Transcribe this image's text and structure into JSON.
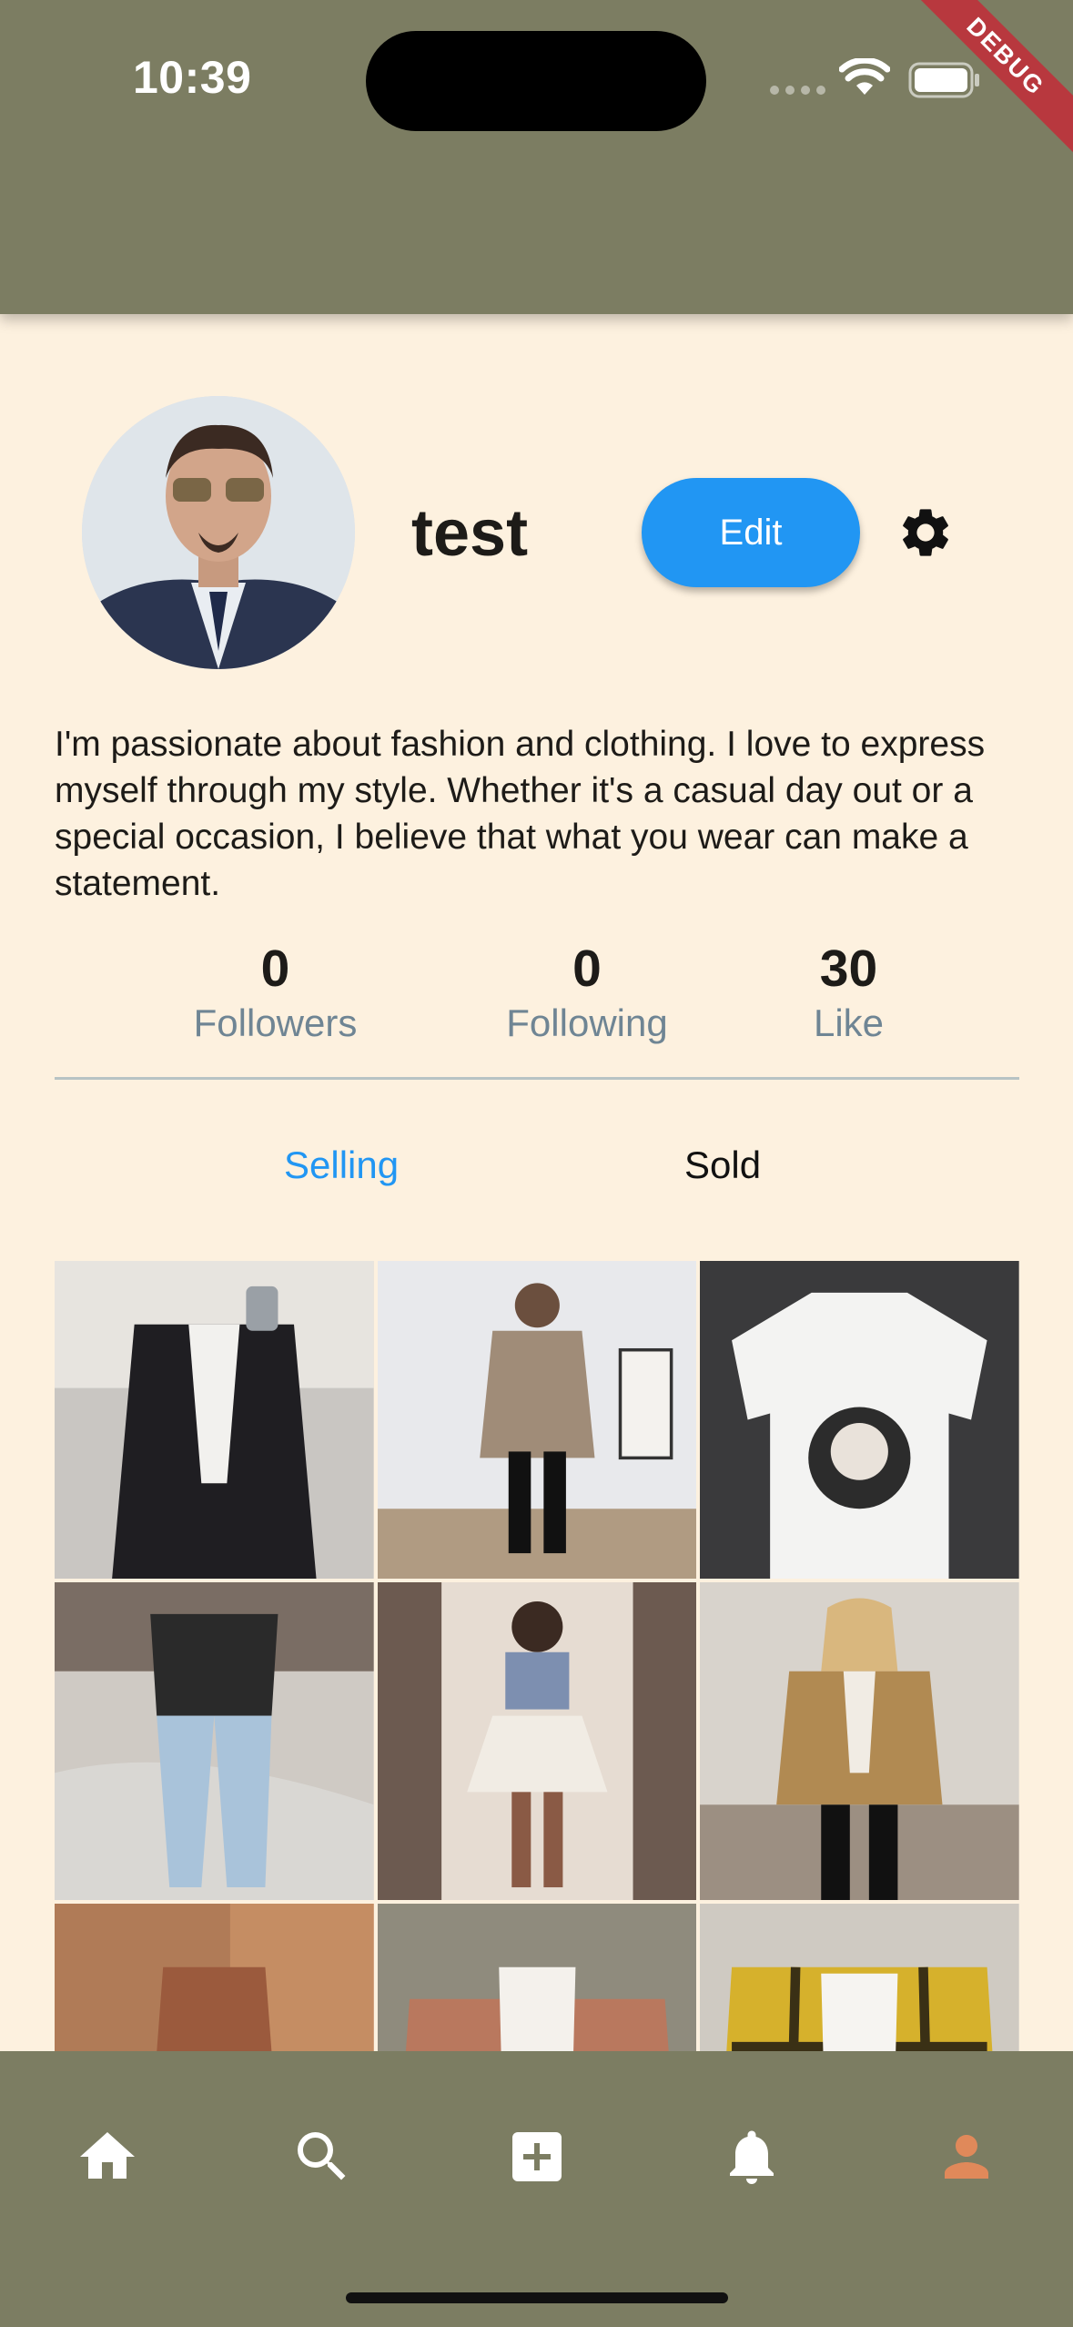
{
  "status_bar": {
    "time": "10:39"
  },
  "debug_banner": "DEBUG",
  "profile": {
    "username": "test",
    "edit_label": "Edit",
    "bio": "I'm passionate about fashion and clothing. I love to express myself through my style. Whether it's a casual day out or a special occasion, I believe that what you wear can make a statement."
  },
  "stats": [
    {
      "value": "0",
      "label": "Followers"
    },
    {
      "value": "0",
      "label": "Following"
    },
    {
      "value": "30",
      "label": "Like"
    }
  ],
  "tabs": [
    {
      "label": "Selling",
      "active": true
    },
    {
      "label": "Sold",
      "active": false
    }
  ],
  "colors": {
    "app_bar": "#7c7d62",
    "background": "#fdf1df",
    "accent": "#2196f3",
    "active_nav": "#e0895a"
  },
  "bottom_nav": [
    {
      "icon": "home-icon"
    },
    {
      "icon": "search-icon"
    },
    {
      "icon": "add-box-icon"
    },
    {
      "icon": "notification-bell-icon"
    },
    {
      "icon": "person-icon",
      "active": true
    }
  ]
}
